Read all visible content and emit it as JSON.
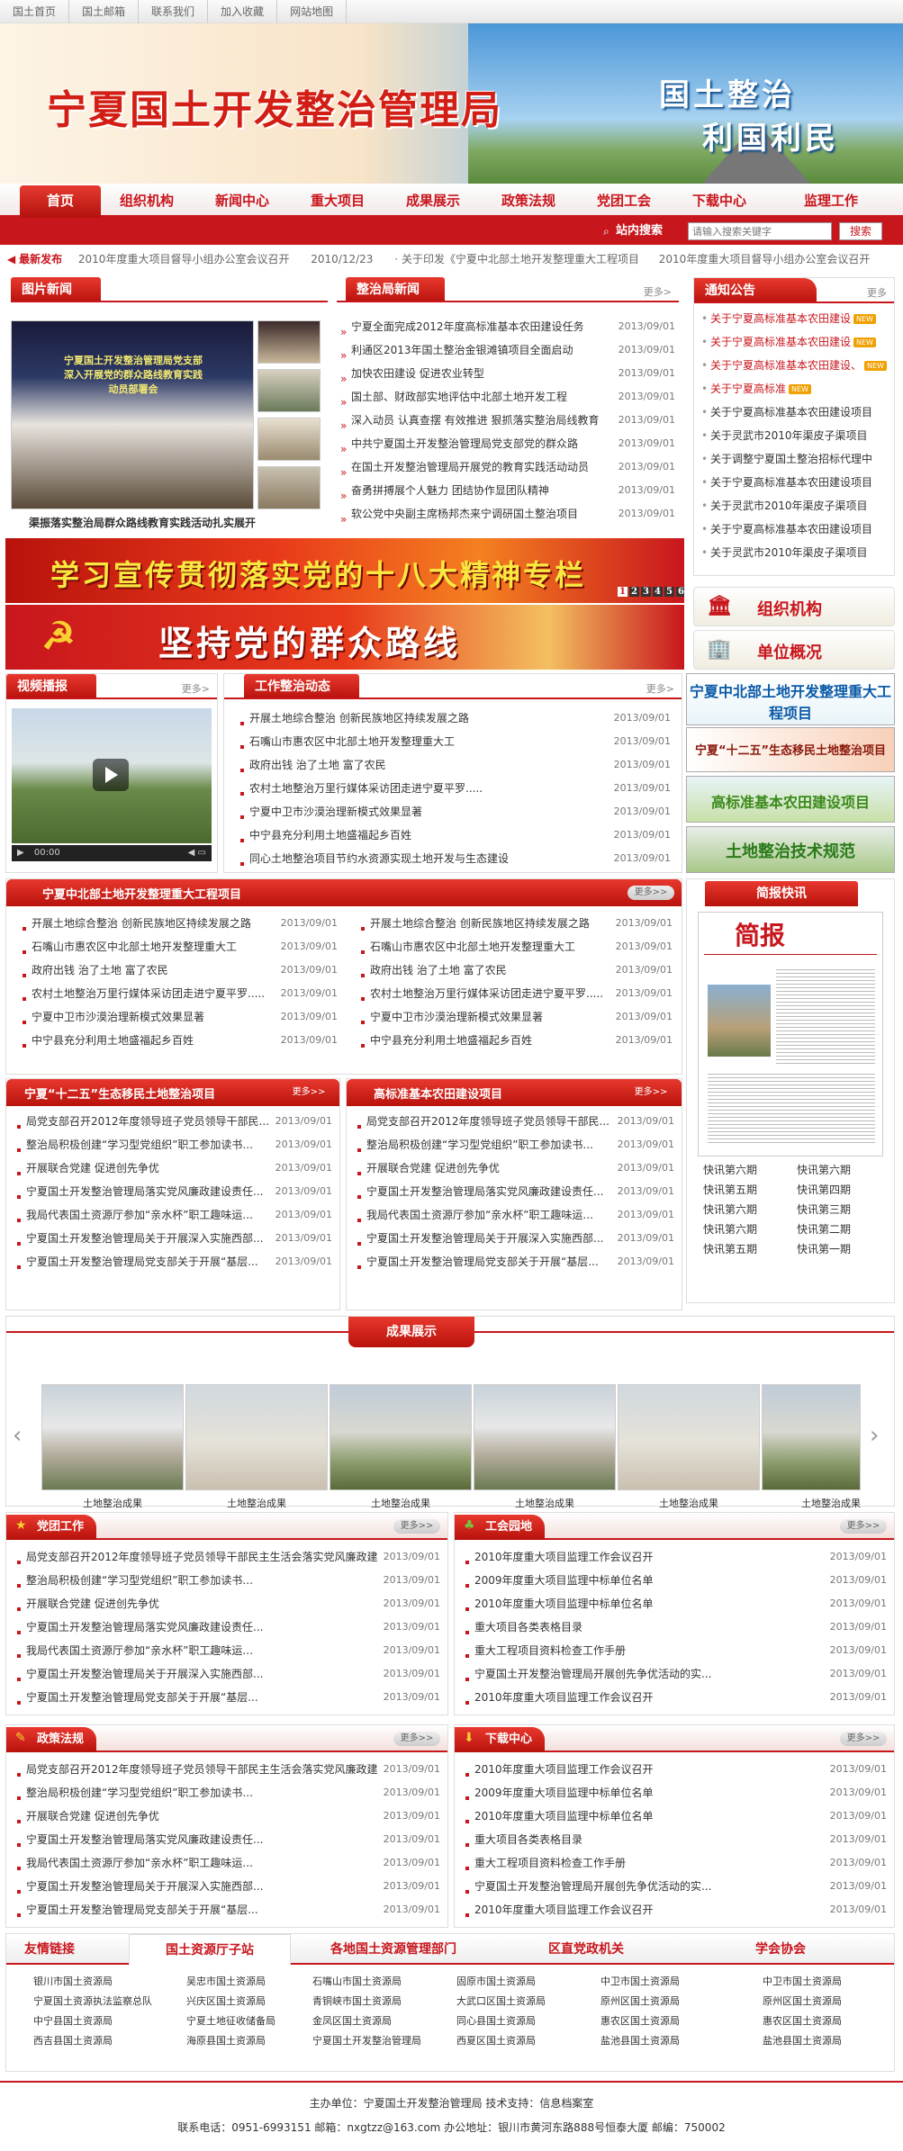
{
  "topbar": [
    "国土首页",
    "国土邮箱",
    "联系我们",
    "加入收藏",
    "网站地图"
  ],
  "banner": {
    "title": "宁夏国土开发整治管理局",
    "slogan1": "国土整治",
    "slogan2": "利国利民"
  },
  "nav": [
    "首页",
    "组织机构",
    "新闻中心",
    "重大项目",
    "成果展示",
    "政策法规",
    "党团工会",
    "下载中心",
    "监理工作"
  ],
  "search": {
    "label": "站内搜索",
    "placeholder": "请输入搜索关键字",
    "button": "搜索"
  },
  "latest": {
    "label": "最新发布",
    "item1": "2010年度重大项目督导小组办公室会议召开",
    "date1": "2010/12/23",
    "item2": "关于印发《宁夏中北部土地开发整理重大工程项目",
    "item3": "2010年度重大项目督导小组办公室会议召开"
  },
  "pic_news": {
    "title": "图片新闻",
    "caption": "渠振落实整治局群众路线教育实践活动扎实展开",
    "photo_text1": "宁夏国土开发整治管理局党支部",
    "photo_text2": "深入开展党的群众路线教育实践",
    "photo_text3": "动员部署会"
  },
  "bureau_news": {
    "title": "整治局新闻",
    "more": "更多>",
    "items": [
      {
        "t": "宁夏全面完成2012年度高标准基本农田建设任务",
        "d": "2013/09/01"
      },
      {
        "t": "利通区2013年国土整治金银滩镇项目全面启动",
        "d": "2013/09/01"
      },
      {
        "t": "加快农田建设 促进农业转型",
        "d": "2013/09/01"
      },
      {
        "t": "国土部、财政部实地评估中北部土地开发工程",
        "d": "2013/09/01"
      },
      {
        "t": "深入动员 认真查摆 有效推进 狠抓落实整治局线教育",
        "d": "2013/09/01"
      },
      {
        "t": "中共宁夏国土开发整治管理局党支部党的群众路",
        "d": "2013/09/01"
      },
      {
        "t": "在国土开发整治管理局开展党的教育实践活动动员",
        "d": "2013/09/01"
      },
      {
        "t": "奋勇拼搏展个人魅力 团结协作显团队精神",
        "d": "2013/09/01"
      },
      {
        "t": "软公党中央副主席杨邦杰来宁调研国土整治项目",
        "d": "2013/09/01"
      }
    ]
  },
  "notice": {
    "title": "通知公告",
    "more": "更多",
    "new": "NEW",
    "items": [
      {
        "t": "关于宁夏高标准基本农田建设",
        "hot": true
      },
      {
        "t": "关于宁夏高标准基本农田建设",
        "hot": true
      },
      {
        "t": "关于宁夏高标准基本农田建设、",
        "hot": true
      },
      {
        "t": "关于宁夏高标准",
        "hot": true
      },
      {
        "t": "关于宁夏高标准基本农田建设项目",
        "hot": false
      },
      {
        "t": "关于灵武市2010年渠皮子渠项目",
        "hot": false
      },
      {
        "t": "关于调整宁夏国土整治招标代理中",
        "hot": false
      },
      {
        "t": "关于宁夏高标准基本农田建设项目",
        "hot": false
      },
      {
        "t": "关于灵武市2010年渠皮子渠项目",
        "hot": false
      },
      {
        "t": "关于宁夏高标准基本农田建设项目",
        "hot": false
      },
      {
        "t": "关于灵武市2010年渠皮子渠项目",
        "hot": false
      }
    ]
  },
  "banner_study": {
    "text": "学习宣传贯彻落实党的十八大精神专栏",
    "pages": [
      "1",
      "2",
      "3",
      "4",
      "5",
      "6"
    ]
  },
  "banner_mass": {
    "text": "坚持党的群众路线"
  },
  "side_buttons": [
    "组织机构",
    "单位概况"
  ],
  "video": {
    "title": "视频播报",
    "more": "更多>",
    "time": "00:00"
  },
  "work_news": {
    "title": "工作整治动态",
    "more": "更多>",
    "items": [
      {
        "t": "开展土地综合整治 创新民族地区持续发展之路",
        "d": "2013/09/01"
      },
      {
        "t": "石嘴山市惠农区中北部土地开发整理重大工",
        "d": "2013/09/01"
      },
      {
        "t": "政府出钱 治了土地 富了农民",
        "d": "2013/09/01"
      },
      {
        "t": "农村土地整治万里行媒体采访团走进宁夏平罗.....",
        "d": "2013/09/01"
      },
      {
        "t": "宁夏中卫市沙漠治理新模式效果显著",
        "d": "2013/09/01"
      },
      {
        "t": "中宁县充分利用土地盛福起乡百姓",
        "d": "2013/09/01"
      },
      {
        "t": "同心土地整治项目节约水资源实现土地开发与生态建设",
        "d": "2013/09/01"
      }
    ]
  },
  "ads": [
    "宁夏中北部土地开发整理重大工程项目",
    "宁夏“十二五”生态移民土地整治项目",
    "高标准基本农田建设项目",
    "土地整治技术规范"
  ],
  "major": {
    "title": "宁夏中北部土地开发整理重大工程项目",
    "more": "更多>>",
    "left": [
      {
        "t": "开展土地综合整治 创新民族地区持续发展之路",
        "d": "2013/09/01"
      },
      {
        "t": "石嘴山市惠农区中北部土地开发整理重大工",
        "d": "2013/09/01"
      },
      {
        "t": "政府出钱 治了土地 富了农民",
        "d": "2013/09/01"
      },
      {
        "t": "农村土地整治万里行媒体采访团走进宁夏平罗.....",
        "d": "2013/09/01"
      },
      {
        "t": "宁夏中卫市沙漠治理新模式效果显著",
        "d": "2013/09/01"
      },
      {
        "t": "中宁县充分利用土地盛福起乡百姓",
        "d": "2013/09/01"
      }
    ],
    "right": [
      {
        "t": "开展土地综合整治 创新民族地区持续发展之路",
        "d": "2013/09/01"
      },
      {
        "t": "石嘴山市惠农区中北部土地开发整理重大工",
        "d": "2013/09/01"
      },
      {
        "t": "政府出钱 治了土地 富了农民",
        "d": "2013/09/01"
      },
      {
        "t": "农村土地整治万里行媒体采访团走进宁夏平罗.....",
        "d": "2013/09/01"
      },
      {
        "t": "宁夏中卫市沙漠治理新模式效果显著",
        "d": "2013/09/01"
      },
      {
        "t": "中宁县充分利用土地盛福起乡百姓",
        "d": "2013/09/01"
      }
    ]
  },
  "brief": {
    "title": "简报快讯",
    "paper_title": "简报",
    "links": [
      "快讯第六期",
      "快讯第六期",
      "快讯第五期",
      "快讯第四期",
      "快讯第六期",
      "快讯第三期",
      "快讯第六期",
      "快讯第二期",
      "快讯第五期",
      "快讯第一期"
    ]
  },
  "eco": {
    "title": "宁夏“十二五”生态移民土地整治项目",
    "more": "更多>>",
    "items": [
      {
        "t": "局党支部召开2012年度领导班子党员领导干部民...",
        "d": "2013/09/01"
      },
      {
        "t": "整治局积极创建“学习型党组织”职工参加读书...",
        "d": "2013/09/01"
      },
      {
        "t": "开展联合党建 促进创先争优",
        "d": "2013/09/01"
      },
      {
        "t": "宁夏国土开发整治管理局落实党风廉政建设责任...",
        "d": "2013/09/01"
      },
      {
        "t": "我局代表国土资源厅参加“亲水杯”职工趣味运...",
        "d": "2013/09/01"
      },
      {
        "t": "宁夏国土开发整治管理局关于开展深入实施西部...",
        "d": "2013/09/01"
      },
      {
        "t": "宁夏国土开发整治管理局党支部关于开展“基层...",
        "d": "2013/09/01"
      }
    ]
  },
  "farmland": {
    "title": "高标准基本农田建设项目",
    "more": "更多>>",
    "items": [
      {
        "t": "局党支部召开2012年度领导班子党员领导干部民...",
        "d": "2013/09/01"
      },
      {
        "t": "整治局积极创建“学习型党组织”职工参加读书...",
        "d": "2013/09/01"
      },
      {
        "t": "开展联合党建 促进创先争优",
        "d": "2013/09/01"
      },
      {
        "t": "宁夏国土开发整治管理局落实党风廉政建设责任...",
        "d": "2013/09/01"
      },
      {
        "t": "我局代表国土资源厅参加“亲水杯”职工趣味运...",
        "d": "2013/09/01"
      },
      {
        "t": "宁夏国土开发整治管理局关于开展深入实施西部...",
        "d": "2013/09/01"
      },
      {
        "t": "宁夏国土开发整治管理局党支部关于开展“基层...",
        "d": "2013/09/01"
      }
    ]
  },
  "achievements": {
    "title": "成果展示",
    "captions": [
      "土地整治成果",
      "土地整治成果",
      "土地整治成果",
      "土地整治成果",
      "土地整治成果",
      "土地整治成果"
    ]
  },
  "party": {
    "title": "党团工作",
    "more": "更多>>",
    "items": [
      {
        "t": "局党支部召开2012年度领导班子党员领导干部民主生活会落实党风廉政建设...",
        "d": "2013/09/01"
      },
      {
        "t": "整治局积极创建“学习型党组织”职工参加读书...",
        "d": "2013/09/01"
      },
      {
        "t": "开展联合党建 促进创先争优",
        "d": "2013/09/01"
      },
      {
        "t": "宁夏国土开发整治管理局落实党风廉政建设责任...",
        "d": "2013/09/01"
      },
      {
        "t": "我局代表国土资源厅参加“亲水杯”职工趣味运...",
        "d": "2013/09/01"
      },
      {
        "t": "宁夏国土开发整治管理局关于开展深入实施西部...",
        "d": "2013/09/01"
      },
      {
        "t": "宁夏国土开发整治管理局党支部关于开展“基层...",
        "d": "2013/09/01"
      }
    ]
  },
  "union": {
    "title": "工会园地",
    "more": "更多>>",
    "items": [
      {
        "t": "2010年度重大项目监理工作会议召开",
        "d": "2013/09/01"
      },
      {
        "t": "2009年度重大项目监理中标单位名单",
        "d": "2013/09/01"
      },
      {
        "t": "2010年度重大项目监理中标单位名单",
        "d": "2013/09/01"
      },
      {
        "t": "重大项目各类表格目录",
        "d": "2013/09/01"
      },
      {
        "t": "重大工程项目资料检查工作手册",
        "d": "2013/09/01"
      },
      {
        "t": "宁夏国土开发整治管理局开展创先争优活动的实...",
        "d": "2013/09/01"
      },
      {
        "t": "2010年度重大项目监理工作会议召开",
        "d": "2013/09/01"
      }
    ]
  },
  "policy": {
    "title": "政策法规",
    "more": "更多>>",
    "items": [
      {
        "t": "局党支部召开2012年度领导班子党员领导干部民主生活会落实党风廉政建设...",
        "d": "2013/09/01"
      },
      {
        "t": "整治局积极创建“学习型党组织”职工参加读书...",
        "d": "2013/09/01"
      },
      {
        "t": "开展联合党建 促进创先争优",
        "d": "2013/09/01"
      },
      {
        "t": "宁夏国土开发整治管理局落实党风廉政建设责任...",
        "d": "2013/09/01"
      },
      {
        "t": "我局代表国土资源厅参加“亲水杯”职工趣味运...",
        "d": "2013/09/01"
      },
      {
        "t": "宁夏国土开发整治管理局关于开展深入实施西部...",
        "d": "2013/09/01"
      },
      {
        "t": "宁夏国土开发整治管理局党支部关于开展“基层...",
        "d": "2013/09/01"
      }
    ]
  },
  "download": {
    "title": "下载中心",
    "more": "更多>>",
    "items": [
      {
        "t": "2010年度重大项目监理工作会议召开",
        "d": "2013/09/01"
      },
      {
        "t": "2009年度重大项目监理中标单位名单",
        "d": "2013/09/01"
      },
      {
        "t": "2010年度重大项目监理中标单位名单",
        "d": "2013/09/01"
      },
      {
        "t": "重大项目各类表格目录",
        "d": "2013/09/01"
      },
      {
        "t": "重大工程项目资料检查工作手册",
        "d": "2013/09/01"
      },
      {
        "t": "宁夏国土开发整治管理局开展创先争优活动的实...",
        "d": "2013/09/01"
      },
      {
        "t": "2010年度重大项目监理工作会议召开",
        "d": "2013/09/01"
      }
    ]
  },
  "links": {
    "title": "友情链接",
    "tabs": [
      "国土资源厅子站",
      "各地国土资源管理部门",
      "区直党政机关",
      "学会协会"
    ],
    "rows": [
      [
        "银川市国土资源局",
        "吴忠市国土资源局",
        "石嘴山市国土资源局",
        "固原市国土资源局",
        "中卫市国土资源局",
        "中卫市国土资源局"
      ],
      [
        "宁夏国土资源执法监察总队",
        "兴庆区国土资源局",
        "青铜峡市国土资源局",
        "大武口区国土资源局",
        "原州区国土资源局",
        "原州区国土资源局"
      ],
      [
        "中宁县国土资源局",
        "宁夏土地征收储备局",
        "金凤区国土资源局",
        "同心县国土资源局",
        "惠农区国土资源局",
        "惠农区国土资源局"
      ],
      [
        "西吉县国土资源局",
        "海原县国土资源局",
        "宁夏国土开发整治管理局",
        "西夏区国土资源局",
        "盐池县国土资源局",
        "盐池县国土资源局"
      ]
    ]
  },
  "footer": {
    "line1": "主办单位：宁夏国土开发整治管理局   技术支持：信息档案室",
    "line2": "联系电话：0951-6993151   邮箱：nxgtzz@163.com   办公地址：银川市黄河东路888号恒泰大厦   邮编：750002"
  },
  "colors": {
    "brand_red": "#c8161d"
  }
}
